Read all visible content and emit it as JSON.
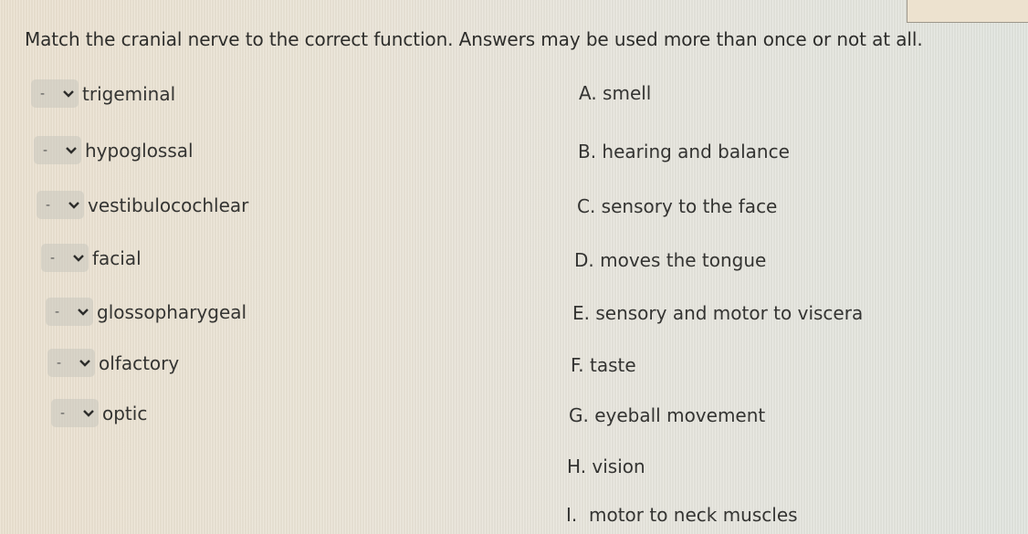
{
  "question": "Match the cranial nerve to the correct function. Answers may be used more than once or not at all.",
  "nerves": [
    {
      "label": "trigeminal",
      "selected": "-"
    },
    {
      "label": "hypoglossal",
      "selected": "-"
    },
    {
      "label": "vestibulocochlear",
      "selected": "-"
    },
    {
      "label": "facial",
      "selected": "-"
    },
    {
      "label": "glossopharygeal",
      "selected": "-"
    },
    {
      "label": "olfactory",
      "selected": "-"
    },
    {
      "label": "optic",
      "selected": "-"
    }
  ],
  "options": [
    "A. smell",
    "B. hearing and balance",
    "C. sensory to the face",
    "D. moves the tongue",
    "E. sensory and motor to viscera",
    "F. taste",
    "G. eyeball movement",
    "H. vision",
    "I.  motor to neck muscles"
  ]
}
